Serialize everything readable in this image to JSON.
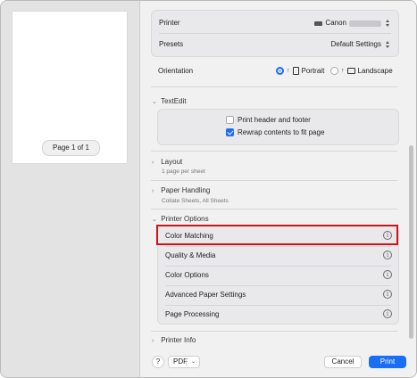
{
  "preview": {
    "page_label": "Page 1 of 1"
  },
  "printer": {
    "label": "Printer",
    "value": "Canon"
  },
  "presets": {
    "label": "Presets",
    "value": "Default Settings"
  },
  "orientation": {
    "label": "Orientation",
    "portrait": "Portrait",
    "landscape": "Landscape",
    "selected": "Portrait"
  },
  "textedit": {
    "header": "TextEdit",
    "options": [
      {
        "label": "Print header and footer",
        "checked": false
      },
      {
        "label": "Rewrap contents to fit page",
        "checked": true
      }
    ]
  },
  "sections": [
    {
      "title": "Layout",
      "subtitle": "1 page per sheet"
    },
    {
      "title": "Paper Handling",
      "subtitle": "Collate Sheets, All Sheets"
    }
  ],
  "printer_options": {
    "header": "Printer Options",
    "items": [
      "Color Matching",
      "Quality & Media",
      "Color Options",
      "Advanced Paper Settings",
      "Page Processing"
    ],
    "highlighted": "Color Matching"
  },
  "printer_info": {
    "title": "Printer Info"
  },
  "footer": {
    "help": "?",
    "pdf": "PDF",
    "cancel": "Cancel",
    "print": "Print"
  },
  "colors": {
    "accent": "#1a6ef5",
    "highlight": "#d0141e"
  }
}
